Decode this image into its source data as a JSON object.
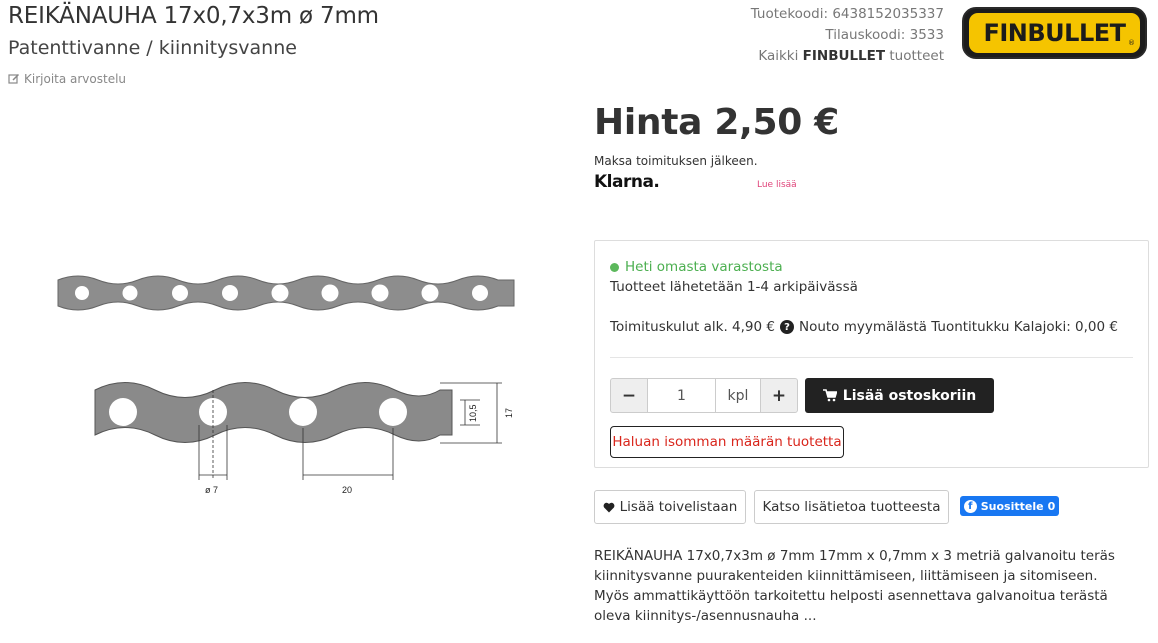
{
  "product": {
    "title": "REIKÄNAUHA 17x0,7x3m ø 7mm",
    "subtitle": "Patenttivanne / kiinnitysvanne",
    "review_link": "Kirjoita arvostelu"
  },
  "codes": {
    "product_code": "Tuotekoodi: 6438152035337",
    "order_code": "Tilauskoodi: 3533",
    "brand_prefix": "Kaikki ",
    "brand_name": "FINBULLET",
    "brand_suffix": " tuotteet"
  },
  "logo": {
    "text": "FINBULLET",
    "reg": "®"
  },
  "drawing": {
    "dim_height_inner": "10,5",
    "dim_height_outer": "17",
    "dim_diameter": "ø 7",
    "dim_spacing": "20"
  },
  "pricing": {
    "price": "Hinta 2,50 €",
    "pay_after": "Maksa toimituksen jälkeen.",
    "klarna": "Klarna.",
    "read_more": "Lue lisää"
  },
  "stock": {
    "status": "Heti omasta varastosta",
    "ship_time": "Tuotteet lähetetään 1-4 arkipäivässä",
    "shipping_cost": "Toimituskulut alk. 4,90 €",
    "pickup": "Nouto myymälästä Tuontitukku Kalajoki: 0,00 €"
  },
  "cart": {
    "minus": "−",
    "quantity": "1",
    "unit": "kpl",
    "plus": "+",
    "add_label": "Lisää ostoskoriin",
    "bulk_label": "Haluan isomman määrän tuotetta"
  },
  "actions": {
    "wishlist": "Lisää toivelistaan",
    "more_info": "Katso lisätietoa tuotteesta",
    "fb_label": "Suosittele",
    "fb_count": "0"
  },
  "description": "REIKÄNAUHA 17x0,7x3m ø 7mm 17mm x 0,7mm x 3 metriä galvanoitu teräs kiinnitysvanne puurakenteiden kiinnittämiseen, liittämiseen ja sitomiseen. Myös ammattikäyttöön tarkoitettu helposti asennettava galvanoitua terästä oleva kiinnitys-/asennusnauha ..."
}
